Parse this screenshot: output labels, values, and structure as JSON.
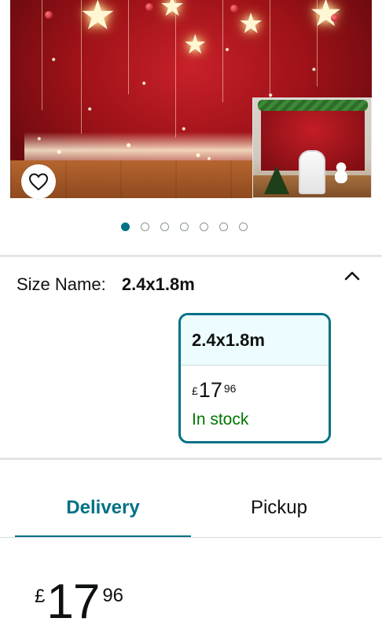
{
  "product_image": {
    "alt_icons": [
      "star-icon",
      "ornament-icon",
      "heart-icon"
    ],
    "image_count": 7,
    "active_index": 0
  },
  "size": {
    "label": "Size Name:",
    "selected": "2.4x1.8m",
    "collapse_icon": "chevron-up-icon"
  },
  "size_option": {
    "name": "2.4x1.8m",
    "price_currency": "£",
    "price_whole": "17",
    "price_fraction": "96",
    "stock": "In stock"
  },
  "tabs": [
    {
      "label": "Delivery",
      "active": true
    },
    {
      "label": "Pickup",
      "active": false
    }
  ],
  "price": {
    "currency": "£",
    "whole": "17",
    "fraction": "96"
  },
  "colors": {
    "accent": "#007185",
    "in_stock": "#007600",
    "selected_bg": "#edfdff"
  }
}
